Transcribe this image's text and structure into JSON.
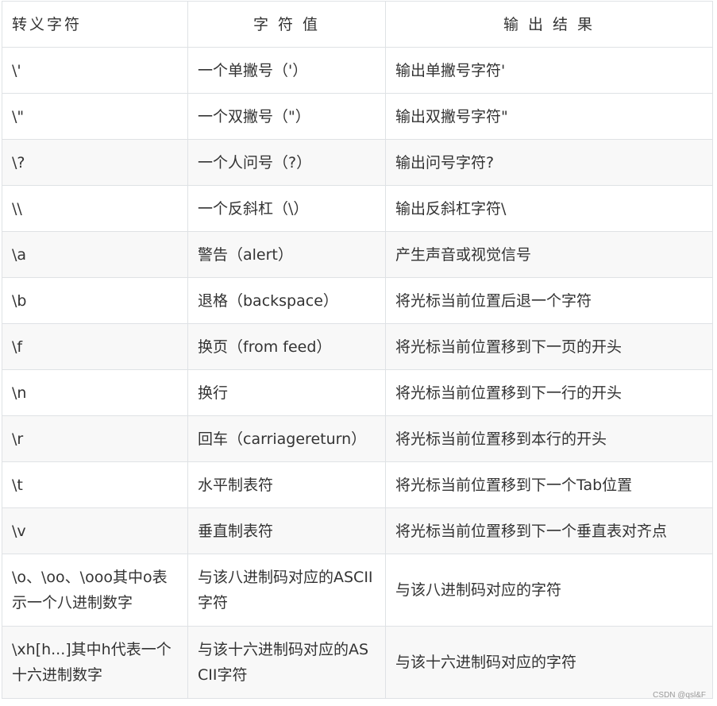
{
  "table": {
    "headers": [
      "转义字符",
      "字 符 值",
      "输 出 结 果"
    ],
    "rows": [
      [
        "\\'",
        "一个单撇号（'）",
        "输出单撇号字符'"
      ],
      [
        "\\\"",
        "一个双撇号（\"）",
        "输出双撇号字符\""
      ],
      [
        "\\?",
        "一个人问号（?）",
        "输出问号字符?"
      ],
      [
        "\\\\",
        "一个反斜杠（\\）",
        "输出反斜杠字符\\"
      ],
      [
        "\\a",
        "警告（alert）",
        "产生声音或视觉信号"
      ],
      [
        "\\b",
        "退格（backspace）",
        "将光标当前位置后退一个字符"
      ],
      [
        "\\f",
        "换页（from feed）",
        "将光标当前位置移到下一页的开头"
      ],
      [
        "\\n",
        "换行",
        "将光标当前位置移到下一行的开头"
      ],
      [
        "\\r",
        "回车（carriagereturn）",
        "将光标当前位置移到本行的开头"
      ],
      [
        "\\t",
        "水平制表符",
        "将光标当前位置移到下一个Tab位置"
      ],
      [
        "\\v",
        "垂直制表符",
        "将光标当前位置移到下一个垂直表对齐点"
      ],
      [
        "\\o、\\oo、\\ooo其中o表示一个八进制数字",
        "与该八进制码对应的ASCII字符",
        "与该八进制码对应的字符"
      ],
      [
        "\\xh[h...]其中h代表一个十六进制数字",
        "与该十六进制码对应的ASCII字符",
        "与该十六进制码对应的字符"
      ]
    ]
  },
  "watermark": "CSDN @qsl&F"
}
